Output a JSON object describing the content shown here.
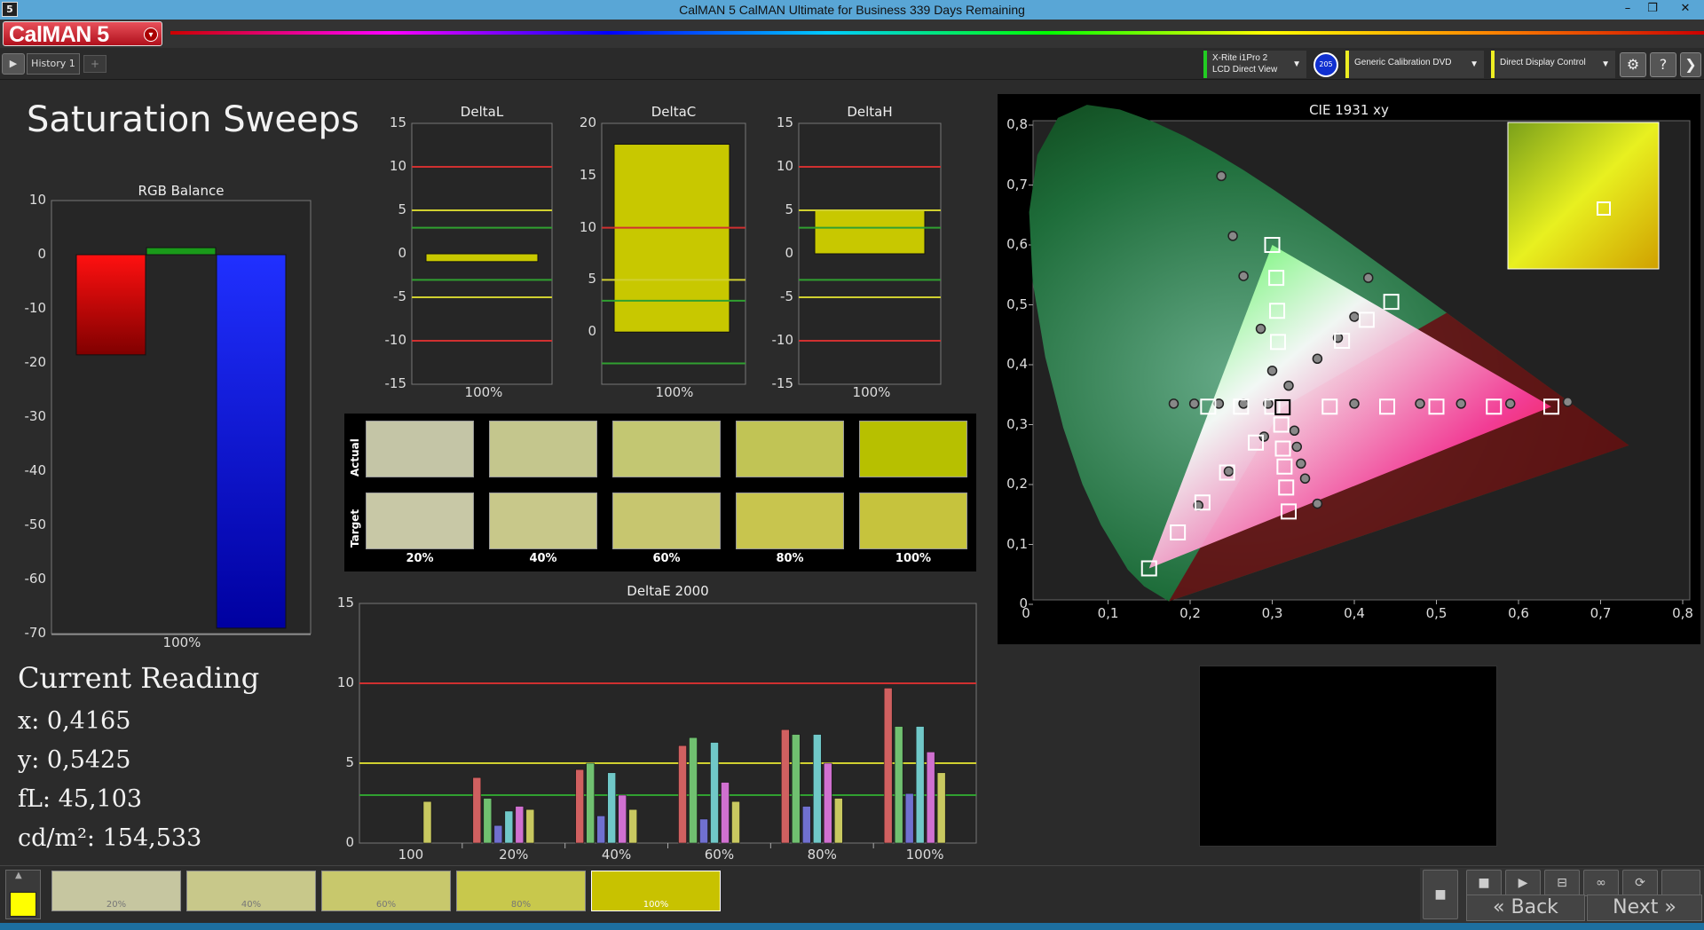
{
  "window": {
    "app_icon": "5",
    "title": "CalMAN 5 CalMAN Ultimate for Business 339 Days Remaining",
    "minimize": "–",
    "restore": "❐",
    "close": "✕"
  },
  "header": {
    "logo": "CalMAN 5",
    "logo_menu_icon": "▾"
  },
  "toolbar": {
    "play_icon": "▶",
    "tab_label": "History 1",
    "add_tab_icon": "+",
    "meter_line1": "X-Rite i1Pro 2",
    "meter_line2": "LCD Direct View",
    "meter_badge": "205",
    "source": "Generic Calibration DVD",
    "display": "Direct Display Control",
    "settings_icon": "⚙",
    "help_icon": "?",
    "expand_icon": "❯"
  },
  "page_title": "Saturation Sweeps",
  "rgb_balance": {
    "title": "RGB Balance",
    "ylim": [
      -70,
      10
    ],
    "yticks": [
      "10",
      "0",
      "-10",
      "-20",
      "-30",
      "-40",
      "-50",
      "-60",
      "-70"
    ],
    "xlabel": "100%",
    "values": {
      "red": -18.5,
      "green": 1.3,
      "blue": -69
    }
  },
  "delta_l": {
    "title": "DeltaL",
    "yticks": [
      "15",
      "10",
      "5",
      "0",
      "-5",
      "-10",
      "-15"
    ],
    "xlabel": "100%",
    "value": -0.9
  },
  "delta_c": {
    "title": "DeltaC",
    "yticks": [
      "20",
      "15",
      "10",
      "5",
      "0"
    ],
    "xlabel": "100%",
    "value": 18
  },
  "delta_h": {
    "title": "DeltaH",
    "yticks": [
      "15",
      "10",
      "5",
      "0",
      "-5",
      "-10",
      "-15"
    ],
    "xlabel": "100%",
    "value": 5
  },
  "swatches": {
    "actual_label": "Actual",
    "target_label": "Target",
    "labels": [
      "20%",
      "40%",
      "60%",
      "80%",
      "100%"
    ],
    "actual_colors": [
      "#c4c5a6",
      "#c4c68d",
      "#c3c772",
      "#c1c455",
      "#b7c000"
    ],
    "target_colors": [
      "#c8c8a6",
      "#c8c88a",
      "#c7c66f",
      "#c8c54e",
      "#c6c33d"
    ]
  },
  "current_reading": {
    "title": "Current Reading",
    "x": "x: 0,4165",
    "y": "y: 0,5425",
    "fl": "fL: 45,103",
    "cdm2": "cd/m²: 154,533"
  },
  "cie": {
    "title": "CIE 1931 xy",
    "xticks": [
      "0",
      "0,1",
      "0,2",
      "0,3",
      "0,4",
      "0,5",
      "0,6",
      "0,7",
      "0,8"
    ],
    "yticks": [
      "0",
      "0,1",
      "0,2",
      "0,3",
      "0,4",
      "0,5",
      "0,6",
      "0,7",
      "0,8"
    ]
  },
  "chart_data": [
    {
      "type": "bar",
      "title": "DeltaE 2000",
      "categories": [
        "100",
        "20%",
        "40%",
        "60%",
        "80%",
        "100%"
      ],
      "ylim": [
        0,
        15
      ],
      "yticks": [
        "15",
        "10",
        "5",
        "0"
      ],
      "thresholds": {
        "red": 10,
        "yellow": 5,
        "green": 3
      },
      "series": [
        {
          "color": "#d06060",
          "values": [
            0,
            4.1,
            4.6,
            6.1,
            7.1,
            9.7
          ]
        },
        {
          "color": "#70c070",
          "values": [
            0,
            2.8,
            5.0,
            6.6,
            6.8,
            7.3
          ]
        },
        {
          "color": "#7070d0",
          "values": [
            0,
            1.1,
            1.7,
            1.5,
            2.3,
            3.1
          ]
        },
        {
          "color": "#70c8c8",
          "values": [
            0,
            2.0,
            4.4,
            6.3,
            6.8,
            7.3
          ]
        },
        {
          "color": "#d070d0",
          "values": [
            0,
            2.3,
            3.0,
            3.8,
            5.0,
            5.7
          ]
        },
        {
          "color": "#c8c860",
          "values": [
            2.6,
            2.1,
            2.1,
            2.6,
            2.8,
            4.4
          ]
        }
      ]
    },
    {
      "type": "scatter",
      "title": "CIE 1931 xy",
      "xlim": [
        0,
        0.8
      ],
      "ylim": [
        0,
        0.8
      ],
      "gamut": [
        [
          0.64,
          0.33
        ],
        [
          0.3,
          0.6
        ],
        [
          0.15,
          0.06
        ]
      ],
      "white": [
        0.3127,
        0.329
      ],
      "targets": [
        [
          0.222,
          0.33
        ],
        [
          0.262,
          0.33
        ],
        [
          0.3,
          0.33
        ],
        [
          0.37,
          0.33
        ],
        [
          0.44,
          0.33
        ],
        [
          0.5,
          0.33
        ],
        [
          0.57,
          0.33
        ],
        [
          0.64,
          0.33
        ],
        [
          0.3,
          0.6
        ],
        [
          0.305,
          0.545
        ],
        [
          0.306,
          0.49
        ],
        [
          0.307,
          0.438
        ],
        [
          0.445,
          0.505
        ],
        [
          0.415,
          0.475
        ],
        [
          0.385,
          0.44
        ],
        [
          0.15,
          0.06
        ],
        [
          0.185,
          0.12
        ],
        [
          0.215,
          0.17
        ],
        [
          0.245,
          0.22
        ],
        [
          0.28,
          0.27
        ],
        [
          0.32,
          0.155
        ],
        [
          0.317,
          0.195
        ],
        [
          0.315,
          0.23
        ],
        [
          0.313,
          0.26
        ],
        [
          0.311,
          0.3
        ]
      ],
      "measured": [
        [
          0.18,
          0.335
        ],
        [
          0.205,
          0.335
        ],
        [
          0.235,
          0.335
        ],
        [
          0.265,
          0.335
        ],
        [
          0.295,
          0.335
        ],
        [
          0.4,
          0.335
        ],
        [
          0.48,
          0.335
        ],
        [
          0.53,
          0.335
        ],
        [
          0.59,
          0.335
        ],
        [
          0.66,
          0.338
        ],
        [
          0.238,
          0.715
        ],
        [
          0.252,
          0.615
        ],
        [
          0.265,
          0.548
        ],
        [
          0.286,
          0.46
        ],
        [
          0.3,
          0.39
        ],
        [
          0.32,
          0.365
        ],
        [
          0.417,
          0.545
        ],
        [
          0.4,
          0.48
        ],
        [
          0.38,
          0.445
        ],
        [
          0.355,
          0.41
        ],
        [
          0.21,
          0.165
        ],
        [
          0.247,
          0.222
        ],
        [
          0.29,
          0.28
        ],
        [
          0.327,
          0.29
        ],
        [
          0.33,
          0.263
        ],
        [
          0.335,
          0.235
        ],
        [
          0.34,
          0.21
        ],
        [
          0.355,
          0.168
        ]
      ]
    }
  ],
  "bottom": {
    "thumb_labels": [
      "20%",
      "40%",
      "60%",
      "80%",
      "100%"
    ],
    "thumb_colors": [
      "#c6c6a0",
      "#c8c88a",
      "#c8c86c",
      "#c8c84c",
      "#c8c200"
    ],
    "current_color": "#ffff00",
    "back": "Back",
    "next": "Next",
    "back_icon": "«",
    "next_icon": "»",
    "stop_icon": "■",
    "play_icon": "▶",
    "save_icon": "⊟",
    "loop_icon": "∞",
    "refresh_icon": "⟳",
    "scroll_up_icon": "▲"
  }
}
